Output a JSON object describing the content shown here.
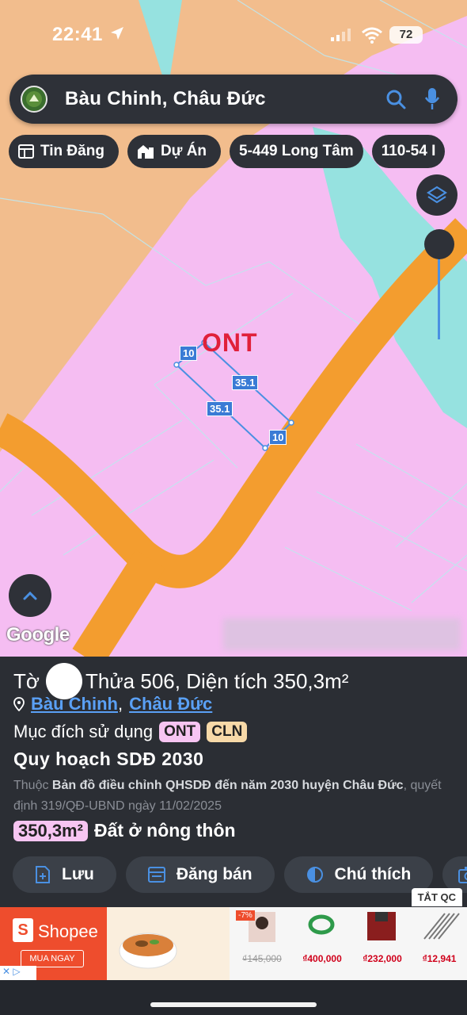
{
  "status": {
    "time": "22:41",
    "battery": "72"
  },
  "search": {
    "query": "Bàu Chinh, Châu Đức"
  },
  "chips": [
    {
      "label": "Tin Đăng",
      "icon": "newspaper-icon"
    },
    {
      "label": "Dự Án",
      "icon": "buildings-icon"
    },
    {
      "label": "5-449 Long Tâm"
    },
    {
      "label": "110-54 I"
    }
  ],
  "map": {
    "zone_label": "ONT",
    "dimensions": [
      "10",
      "35.1",
      "35.1",
      "10"
    ],
    "google_logo": "Google",
    "colors": {
      "residential": "#f5bdf2",
      "agriculture": "#f2bd8d",
      "road": "#f39d2f",
      "water": "#96e2e0",
      "parcel": "#4a90e2"
    }
  },
  "panel": {
    "sheet_prefix": "Tờ",
    "parcel_text": "Thửa 506, Diện tích 350,3m²",
    "commune": "Bàu Chinh",
    "district": "Châu Đức",
    "separator": ",",
    "purpose_label": "Mục đích sử dụng",
    "purpose_badges": [
      {
        "label": "ONT",
        "color": "#f7c5f2"
      },
      {
        "label": "CLN",
        "color": "#f7d9a8"
      }
    ],
    "plan_title": "Quy hoạch SDĐ 2030",
    "plan_source_prefix": "Thuộc",
    "plan_source_name": "Bản đồ điều chỉnh QHSDĐ đến năm 2030 huyện Châu Đức",
    "plan_decision": ", quyết định 319/QĐ-UBND ngày 11/02/2025",
    "area_value": "350,3m²",
    "area_type": "Đất ở nông thôn",
    "actions": [
      {
        "label": "Lưu",
        "icon": "save-plus-icon"
      },
      {
        "label": "Đăng bán",
        "icon": "listing-icon"
      },
      {
        "label": "Chú thích",
        "icon": "legend-icon"
      },
      {
        "label": "",
        "icon": "camera-icon"
      }
    ]
  },
  "ad": {
    "close_label": "TẮT QC",
    "brand": "Shopee",
    "cta": "MUA NGAY",
    "discount": "-7%",
    "prices": [
      "₫145,000",
      "₫400,000",
      "₫232,000",
      "₫12,941"
    ]
  }
}
